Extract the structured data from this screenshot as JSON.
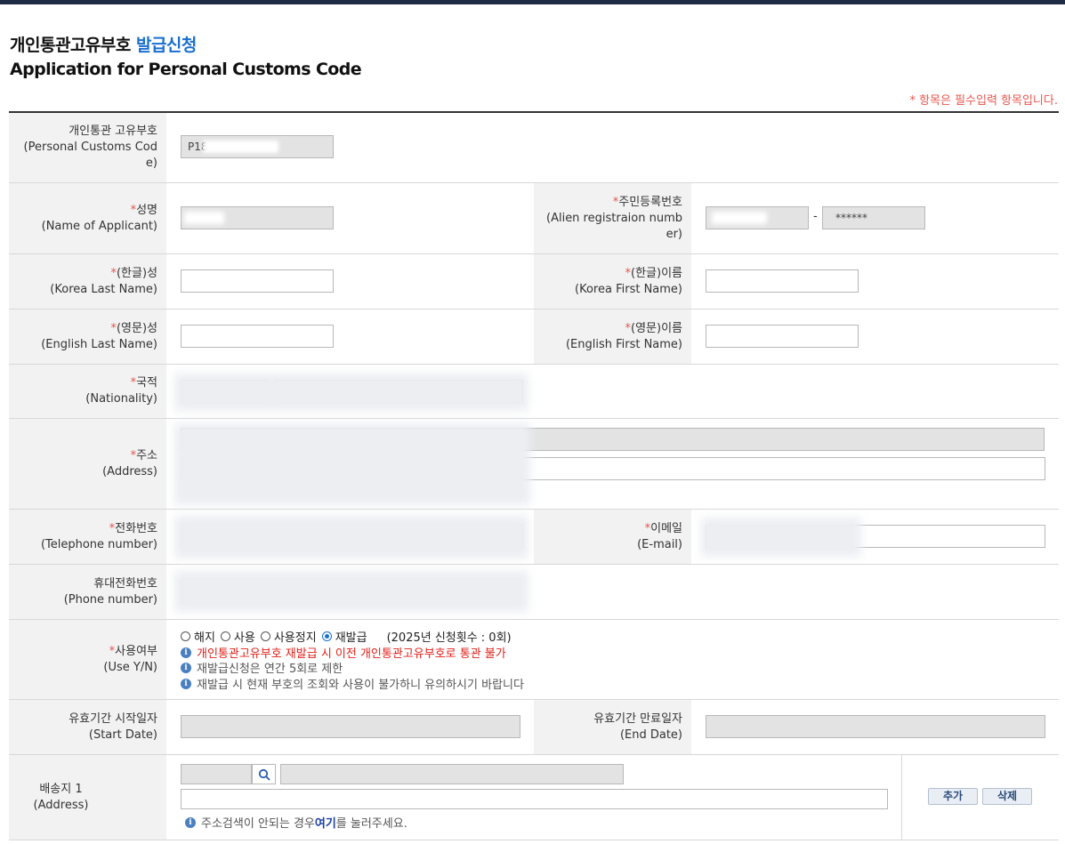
{
  "header": {
    "title_ko_main": "개인통관고유부호",
    "title_ko_accent": "발급신청",
    "title_en": "Application for Personal Customs Code",
    "required_note": "* 항목은 필수입력 항목입니다."
  },
  "form": {
    "customs_code": {
      "label_ko": "개인통관 고유부호",
      "label_en_1": "(Personal Customs Cod",
      "label_en_2": "e)",
      "value": "P18"
    },
    "name": {
      "req": "*",
      "label_ko": "성명",
      "label_en": "(Name of Applicant)"
    },
    "alien_reg": {
      "req": "*",
      "label_ko": "주민등록번호",
      "label_en_1": "(Alien registraion numb",
      "label_en_2": "er)",
      "separator": "-",
      "masked": "******"
    },
    "korea_last": {
      "req": "*",
      "label_ko": "(한글)성",
      "label_en": "(Korea Last Name)"
    },
    "korea_first": {
      "req": "*",
      "label_ko": "(한글)이름",
      "label_en": "(Korea First Name)"
    },
    "english_last": {
      "req": "*",
      "label_ko": "(영문)성",
      "label_en": "(English Last Name)"
    },
    "english_first": {
      "req": "*",
      "label_ko": "(영문)이름",
      "label_en": "(English First Name)"
    },
    "nationality": {
      "req": "*",
      "label_ko": "국적",
      "label_en": "(Nationality)"
    },
    "address": {
      "req": "*",
      "label_ko": "주소",
      "label_en": "(Address)"
    },
    "telephone": {
      "req": "*",
      "label_ko": "전화번호",
      "label_en": "(Telephone number)"
    },
    "email": {
      "req": "*",
      "label_ko": "이메일",
      "label_en": "(E-mail)"
    },
    "mobile": {
      "label_ko": "휴대전화번호",
      "label_en": "(Phone number)"
    },
    "use_yn": {
      "req": "*",
      "label_ko": "사용여부",
      "label_en": "(Use Y/N)",
      "options": [
        "해지",
        "사용",
        "사용정지",
        "재발급"
      ],
      "selected": "재발급",
      "count_text": "(2025년 신청횟수 : 0회)",
      "notice_1": "개인통관고유부호 재발급 시 이전 개인통관고유부호로 통관 불가",
      "notice_2": "재발급신청은 연간 5회로 제한",
      "notice_3": "재발급 시 현재 부호의 조회와 사용이 불가하니 유의하시기 바랍니다"
    },
    "start_date": {
      "label_ko": "유효기간 시작일자",
      "label_en": "(Start Date)"
    },
    "end_date": {
      "label_ko": "유효기간 만료일자",
      "label_en": "(End Date)"
    },
    "delivery": {
      "label_ko": "배송지 1",
      "label_en": "(Address)",
      "hint_pre": "주소검색이 안되는 경우 ",
      "hint_link": "여기",
      "hint_post": "를 눌러주세요.",
      "add_button": "추가",
      "delete_button": "삭제"
    }
  },
  "icons": {
    "info": "info-icon",
    "search": "search-icon"
  },
  "colors": {
    "accent": "#1a6fd0",
    "required": "#e8554e",
    "warning": "#e0201a",
    "label_bg": "#f2f2f2"
  }
}
